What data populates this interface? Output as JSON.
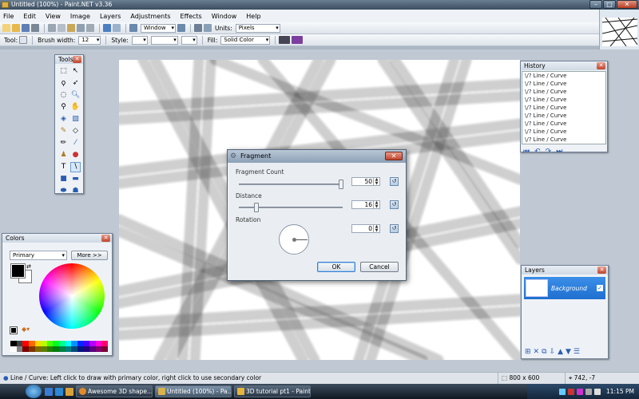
{
  "window": {
    "title": "Untitled (100%) - Paint.NET v3.36"
  },
  "menu": [
    "File",
    "Edit",
    "View",
    "Image",
    "Layers",
    "Adjustments",
    "Effects",
    "Window",
    "Help"
  ],
  "toolbar1": {
    "zoom_combo": "Window",
    "units_label": "Units:",
    "units_value": "Pixels"
  },
  "toolbar2": {
    "tool_label": "Tool:",
    "brush_label": "Brush width:",
    "brush_value": "12",
    "style_label": "Style:",
    "fill_label": "Fill:",
    "fill_value": "Solid Color"
  },
  "tools_panel": {
    "title": "Tools",
    "tools": [
      "rect-select",
      "move-select",
      "lasso",
      "move-pixels",
      "ellipse-select",
      "zoom",
      "magic-wand",
      "pan",
      "paint-bucket",
      "gradient",
      "paintbrush",
      "eraser",
      "pencil",
      "color-picker",
      "clone-stamp",
      "recolor",
      "text",
      "line-curve",
      "rectangle",
      "rounded-rect",
      "ellipse",
      "freeform"
    ]
  },
  "history_panel": {
    "title": "History",
    "items": [
      "Line / Curve",
      "Line / Curve",
      "Line / Curve",
      "Line / Curve",
      "Line / Curve",
      "Line / Curve",
      "Line / Curve",
      "Line / Curve",
      "Line / Curve",
      "Line / Curve"
    ]
  },
  "layers_panel": {
    "title": "Layers",
    "layer_name": "Background"
  },
  "colors_panel": {
    "title": "Colors",
    "mode": "Primary",
    "more_label": "More >>",
    "primary": "#000000",
    "secondary": "#ffffff"
  },
  "dialog": {
    "title": "Fragment",
    "fragment_count_label": "Fragment Count",
    "fragment_count": "50",
    "distance_label": "Distance",
    "distance": "16",
    "rotation_label": "Rotation",
    "rotation": "0",
    "ok": "OK",
    "cancel": "Cancel"
  },
  "status": {
    "message": "Line / Curve: Left click to draw with primary color, right click to use secondary color",
    "image_size": "800 x 600",
    "cursor": "742, -7"
  },
  "taskbar": {
    "tasks": [
      "Awesome 3D shape...",
      "Untitled (100%) - Pa...",
      "3D tutorial pt1 - Paint"
    ],
    "time": "11:15 PM"
  }
}
